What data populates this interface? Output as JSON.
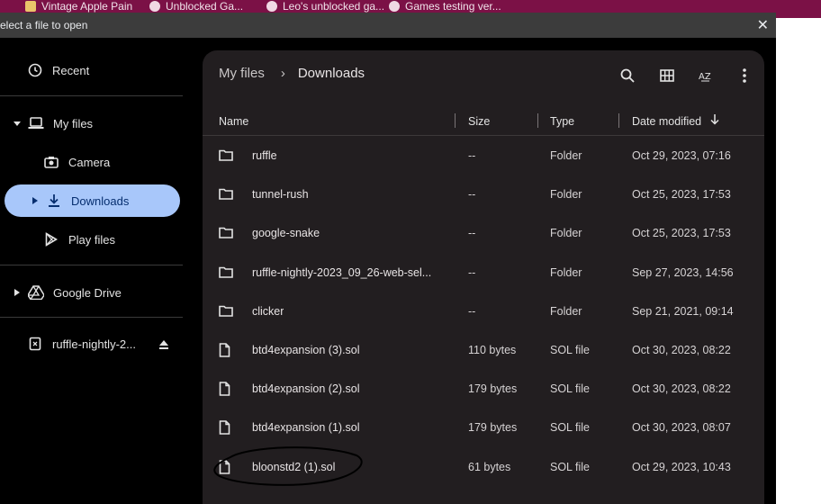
{
  "bookmarks": [
    {
      "label": "Vintage Apple Pain"
    },
    {
      "label": "Unblocked Ga..."
    },
    {
      "label": "Leo's unblocked ga..."
    },
    {
      "label": "Games testing ver..."
    }
  ],
  "dialog": {
    "title": "elect a file to open",
    "close_icon": "close-icon"
  },
  "sidebar": {
    "recent": "Recent",
    "my_files": "My files",
    "camera": "Camera",
    "downloads": "Downloads",
    "play_files": "Play files",
    "google_drive": "Google Drive",
    "usb": "ruffle-nightly-2..."
  },
  "breadcrumb": {
    "root": "My files",
    "separator": "›",
    "current": "Downloads"
  },
  "toolbar": {
    "search": "search-icon",
    "grid": "grid-view-icon",
    "sort": "sort-az-icon",
    "more": "more-vert-icon"
  },
  "columns": {
    "name": "Name",
    "size": "Size",
    "type": "Type",
    "date": "Date modified"
  },
  "files": [
    {
      "name": "ruffle",
      "size": "--",
      "type": "Folder",
      "date": "Oct 29, 2023, 07:16",
      "kind": "folder"
    },
    {
      "name": "tunnel-rush",
      "size": "--",
      "type": "Folder",
      "date": "Oct 25, 2023, 17:53",
      "kind": "folder"
    },
    {
      "name": "google-snake",
      "size": "--",
      "type": "Folder",
      "date": "Oct 25, 2023, 17:53",
      "kind": "folder"
    },
    {
      "name": "ruffle-nightly-2023_09_26-web-sel...",
      "size": "--",
      "type": "Folder",
      "date": "Sep 27, 2023, 14:56",
      "kind": "folder"
    },
    {
      "name": "clicker",
      "size": "--",
      "type": "Folder",
      "date": "Sep 21, 2021, 09:14",
      "kind": "folder"
    },
    {
      "name": "btd4expansion (3).sol",
      "size": "110 bytes",
      "type": "SOL file",
      "date": "Oct 30, 2023, 08:22",
      "kind": "file"
    },
    {
      "name": "btd4expansion (2).sol",
      "size": "179 bytes",
      "type": "SOL file",
      "date": "Oct 30, 2023, 08:22",
      "kind": "file"
    },
    {
      "name": "btd4expansion (1).sol",
      "size": "179 bytes",
      "type": "SOL file",
      "date": "Oct 30, 2023, 08:07",
      "kind": "file"
    },
    {
      "name": "bloonstd2 (1).sol",
      "size": "61 bytes",
      "type": "SOL file",
      "date": "Oct 29, 2023, 10:43",
      "kind": "file"
    }
  ],
  "colors": {
    "panel_bg": "#221e20",
    "selected_bg": "#a8c7fa",
    "bookmark_bar": "#7b1146"
  }
}
